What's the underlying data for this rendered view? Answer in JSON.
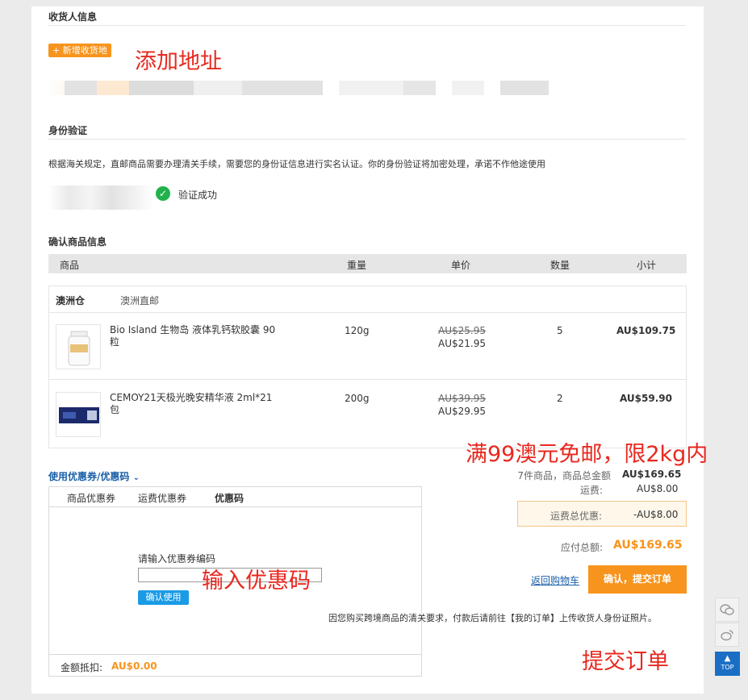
{
  "receiver": {
    "title": "收货人信息",
    "add_address": "+ 新增收货地"
  },
  "identity": {
    "title": "身份验证",
    "notice": "根据海关规定，直邮商品需要办理清关手续，需要您的身份证信息进行实名认证。你的身份验证将加密处理，承诺不作他途使用",
    "status": "验证成功"
  },
  "goods": {
    "title": "确认商品信息",
    "headers": {
      "product": "商品",
      "weight": "重量",
      "price": "单价",
      "qty": "数量",
      "subtotal": "小计"
    },
    "warehouse": "澳洲仓",
    "shipping_mode": "澳洲直邮",
    "items": [
      {
        "name": "Bio Island 生物岛 液体乳钙软胶囊 90粒",
        "weight": "120g",
        "old_price": "AU$25.95",
        "price": "AU$21.95",
        "qty": "5",
        "subtotal": "AU$109.75"
      },
      {
        "name": "CEMOY21天极光晚安精华液 2ml*21包",
        "weight": "200g",
        "old_price": "AU$39.95",
        "price": "AU$29.95",
        "qty": "2",
        "subtotal": "AU$59.90"
      }
    ]
  },
  "coupon": {
    "toggle": "使用优惠券/优惠码",
    "tabs": [
      "商品优惠券",
      "运费优惠券",
      "优惠码"
    ],
    "input_label": "请输入优惠券编码",
    "confirm": "确认使用",
    "deduct_label": "金额抵扣:",
    "deduct_value": "AU$0.00"
  },
  "summary": {
    "goods_label": "7件商品，商品总金额",
    "goods_value": "AU$169.65",
    "shipping_label": "运费:",
    "shipping_value": "AU$8.00",
    "discount_label": "运费总优惠:",
    "discount_value": "-AU$8.00",
    "total_label": "应付总额:",
    "total_value": "AU$169.65",
    "back_cart": "返回购物车",
    "submit": "确认，提交订单",
    "note": "因您购买跨境商品的清关要求，付款后请前往【我的订单】上传收货人身份证照片。"
  },
  "annotations": {
    "add_address": "添加地址",
    "free_shipping": "满99澳元免邮，限2kg内",
    "enter_code": "输入优惠码",
    "submit_order": "提交订单"
  },
  "sidebar": {
    "top": "TOP",
    "wechat_icon": "wechat-icon",
    "weibo_icon": "weibo-icon"
  },
  "colors": {
    "accent": "#f7941d",
    "link": "#1a5fa8",
    "annotation": "#e8281f",
    "success": "#22b14c"
  }
}
